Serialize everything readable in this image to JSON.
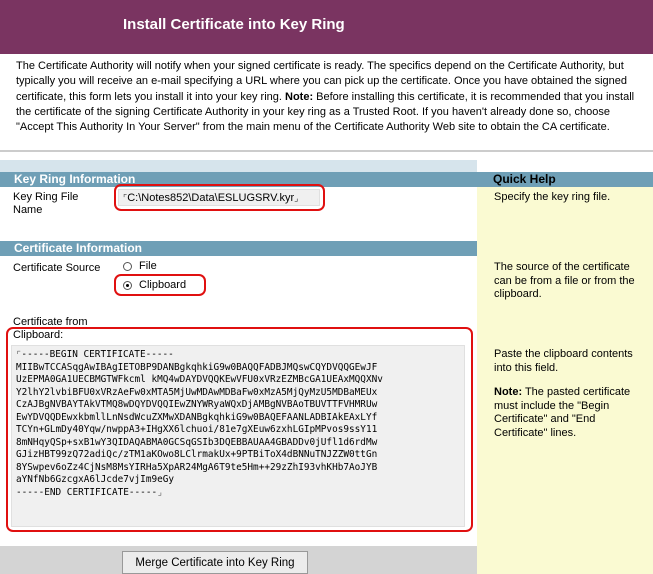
{
  "header": {
    "title": "Install Certificate into Key Ring"
  },
  "intro": {
    "text1": "The Certificate Authority will notify when your signed certificate is ready. The specifics depend on the Certificate Authority, but typically you will receive an e-mail specifying a URL where you can pick up the certificate. Once you have obtained the signed certificate, this form lets you install it into your key ring. ",
    "note_label": "Note:",
    "text2": " Before installing this certificate, it is recommended that you install the certificate of the signing Certificate Authority in your key ring as a Trusted Root.  If you haven't already done so, choose \"Accept This Authority In Your Server\" from the main menu of the Certificate Authority Web site to obtain the CA certificate."
  },
  "key_ring": {
    "section_title": "Key Ring Information",
    "quick_help_title": "Quick Help",
    "file_label": "Key Ring File Name",
    "file_value": "C:\\Notes852\\Data\\ESLUGSRV.kyr",
    "help": "Specify the key ring file."
  },
  "cert_info": {
    "section_title": "Certificate Information",
    "source_label": "Certificate Source",
    "options": [
      "File",
      "Clipboard"
    ],
    "selected": "Clipboard",
    "help": "The source of the certificate can be from a file or from the clipboard."
  },
  "clipboard": {
    "label": "Certificate from Clipboard:",
    "lines": [
      "-----BEGIN CERTIFICATE-----",
      "MIIBwTCCASqgAwIBAgIETOBP9DANBgkqhkiG9w0BAQQFADBJMQswCQYDVQQGEwJF",
      "UzEPMA0GA1UECBMGTWFkcml kMQ4wDAYDVQQKEwVFU0xVRzEZMBcGA1UEAxMQQXNv",
      "Y2lhY2lvbiBFU0xVRzAeFw0xMTA5MjUwMDAwMDBaFw0xMzA5MjQyMzU5MDBaMEUx",
      "CzAJBgNVBAYTAkVTMQ8wDQYDVQQIEwZNYWRyaWQxDjAMBgNVBAoTBUVTTFVHMRUw",
      "EwYDVQQDEwxkbmllLnNsdWcuZXMwXDANBgkqhkiG9w0BAQEFAANLADBIAkEAxLYf",
      "TCYn+GLmDy40Yqw/nwppA3+IHgXX6lchuoi/81e7gXEuw6zxhLGIpMPvos9ssY11",
      "8mNHqyQSp+sxB1wY3QIDAQABMA0GCSqGSIb3DQEBBAUAA4GBADDv0jUfl1d6rdMw",
      "GJizHBT99zQ72adiQc/zTM1aKOwo8LClrmakUx+9PTBiToX4dBNNuTNJZZW0ttGn",
      "8YSwpev6oZz4CjNsM8MsYIRHa5XpAR24MgA6T9te5Hm++29zZhI93vhKHb7AoJYB",
      "aYNfNb6GzcgxA6lJcde7vjIm9eGy",
      "-----END CERTIFICATE-----"
    ],
    "help": "Paste the clipboard contents into this field.",
    "note_label": "Note:",
    "note": " The pasted certificate must include the \"Begin Certificate\" and \"End Certificate\" lines."
  },
  "actions": {
    "merge_label": "Merge Certificate into Key Ring"
  },
  "colors": {
    "header": "#7a3461",
    "section": "#6f9fb6",
    "help_bg": "#fafad2",
    "highlight": "#e01010"
  }
}
